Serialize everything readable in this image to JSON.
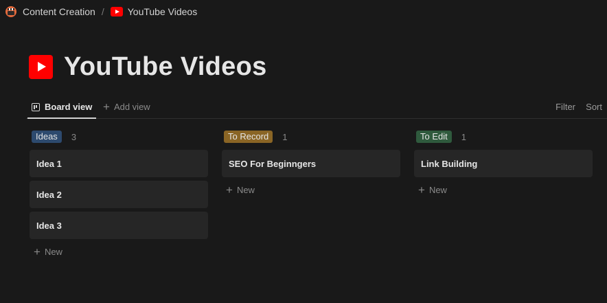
{
  "breadcrumb": {
    "parent": "Content Creation",
    "separator": "/",
    "current": "YouTube Videos"
  },
  "page": {
    "title": "YouTube Videos"
  },
  "views": {
    "active_tab": "Board view",
    "add_view": "Add view",
    "filter": "Filter",
    "sort": "Sort"
  },
  "colors": {
    "ideas_tag": "#2d4a6e",
    "to_record_tag": "#8a6525",
    "to_edit_tag": "#2f5a3d",
    "youtube_red": "#ff0000"
  },
  "icons": {
    "breadcrumb_parent": "clapperboard-icon",
    "page": "youtube-icon",
    "board_view": "board-icon",
    "add": "plus-icon"
  },
  "columns": [
    {
      "name": "Ideas",
      "count": "3",
      "cards": [
        "Idea 1",
        "Idea 2",
        "Idea 3"
      ],
      "new_label": "New"
    },
    {
      "name": "To Record",
      "count": "1",
      "cards": [
        "SEO For Beginngers"
      ],
      "new_label": "New"
    },
    {
      "name": "To Edit",
      "count": "1",
      "cards": [
        "Link Building"
      ],
      "new_label": "New"
    }
  ]
}
